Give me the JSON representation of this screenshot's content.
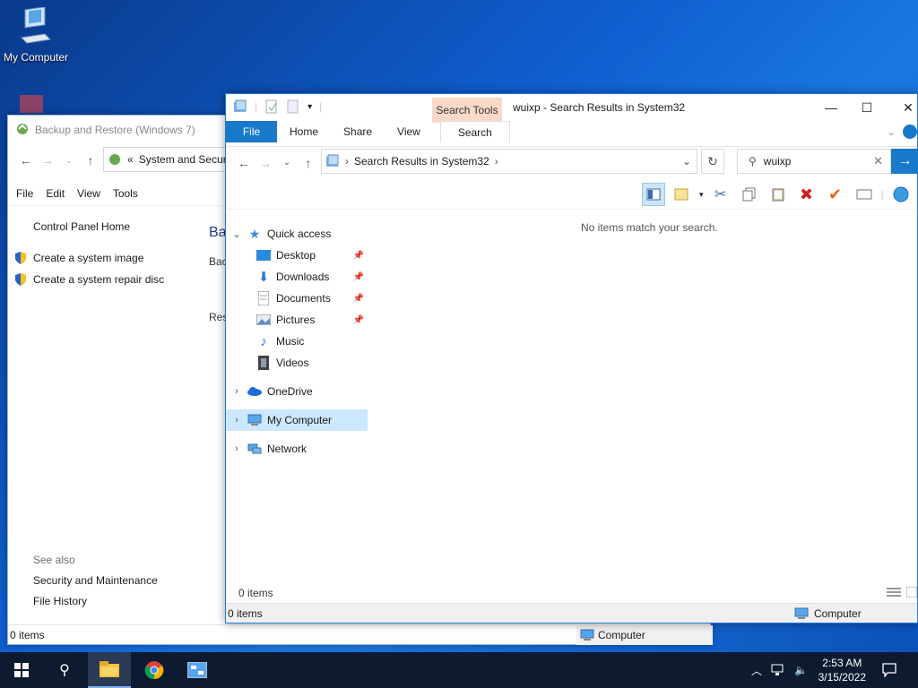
{
  "desktop": {
    "icon_label": "My Computer"
  },
  "back_window": {
    "title": "Backup and Restore (Windows 7)",
    "address": "System and Securi",
    "address_prefix": "«",
    "menu": [
      "File",
      "Edit",
      "View",
      "Tools"
    ],
    "sidebar": {
      "home": "Control Panel Home",
      "tasks": [
        "Create a system image",
        "Create a system repair disc"
      ],
      "see_also_label": "See also",
      "see_also": [
        "Security and Maintenance",
        "File History"
      ]
    },
    "main_heading": "Ba",
    "main_text_1": "Bac",
    "main_text_2": "Res",
    "status_left": "0 items",
    "status_right": "Computer"
  },
  "front_window": {
    "context_tab": "Search Tools",
    "title": "wuixp - Search Results in System32",
    "tabs": [
      "File",
      "Home",
      "Share",
      "View",
      "Search"
    ],
    "address": "Search Results in System32",
    "search_value": "wuixp",
    "tree": {
      "quick_access": "Quick access",
      "items": [
        "Desktop",
        "Downloads",
        "Documents",
        "Pictures",
        "Music",
        "Videos"
      ],
      "onedrive": "OneDrive",
      "my_computer": "My Computer",
      "network": "Network"
    },
    "empty_message": "No items match your search.",
    "count": "0 items",
    "status_left": "0 items",
    "status_right": "Computer"
  },
  "taskbar": {
    "time": "2:53 AM",
    "date": "3/15/2022"
  },
  "colors": {
    "accent": "#1979ca",
    "context_tab": "#f9d9c8",
    "selection": "#cce8ff"
  }
}
